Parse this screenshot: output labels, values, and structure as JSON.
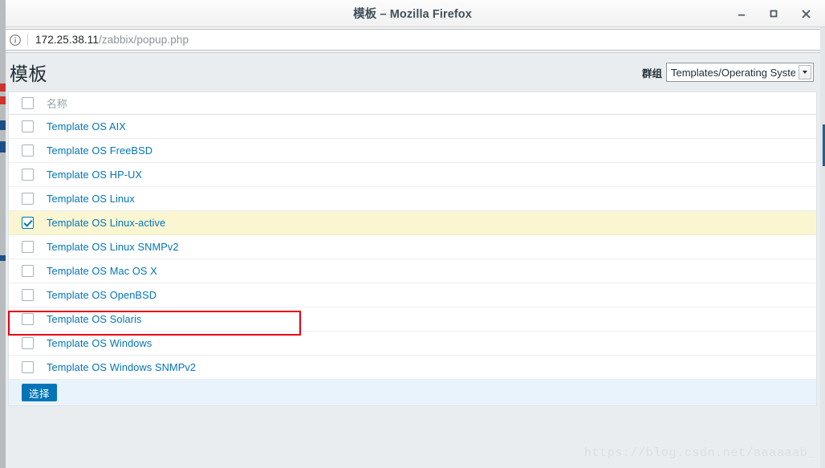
{
  "window": {
    "title": "模板 – Mozilla Firefox",
    "minimize_label": "minimize",
    "maximize_label": "maximize",
    "close_label": "close"
  },
  "urlbar": {
    "host": "172.25.38.11",
    "path": "/zabbix/popup.php",
    "info_icon": "info-icon"
  },
  "page": {
    "title": "模板",
    "group_label": "群组",
    "group_selected": "Templates/Operating Systems"
  },
  "table": {
    "header": "名称",
    "rows": [
      {
        "label": "Template OS AIX",
        "checked": false
      },
      {
        "label": "Template OS FreeBSD",
        "checked": false
      },
      {
        "label": "Template OS HP-UX",
        "checked": false
      },
      {
        "label": "Template OS Linux",
        "checked": false
      },
      {
        "label": "Template OS Linux-active",
        "checked": true
      },
      {
        "label": "Template OS Linux SNMPv2",
        "checked": false
      },
      {
        "label": "Template OS Mac OS X",
        "checked": false
      },
      {
        "label": "Template OS OpenBSD",
        "checked": false
      },
      {
        "label": "Template OS Solaris",
        "checked": false
      },
      {
        "label": "Template OS Windows",
        "checked": false
      },
      {
        "label": "Template OS Windows SNMPv2",
        "checked": false
      }
    ]
  },
  "footer": {
    "select_button": "选择"
  },
  "watermark": "https://blog.csdn.net/aaaaaab_",
  "colors": {
    "link": "#0275b8",
    "highlight_row": "#fbf6d2",
    "annotation": "#e60012",
    "button": "#0275b8",
    "footer_bg": "#e8f3fb"
  }
}
